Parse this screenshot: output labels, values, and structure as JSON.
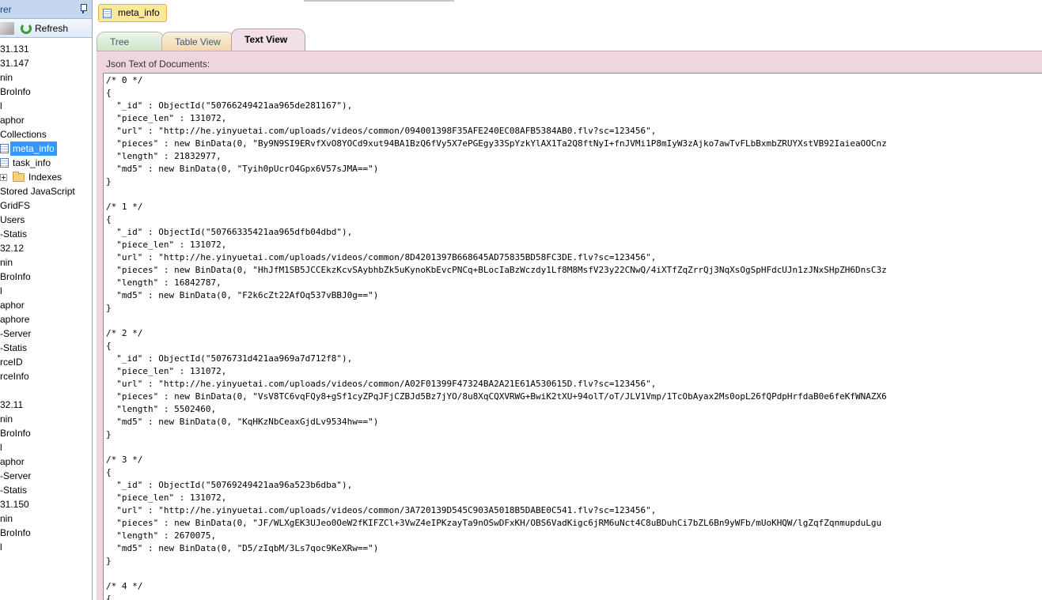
{
  "explorer": {
    "title": "rer",
    "refresh_label": "Refresh",
    "items": [
      {
        "label": "31.131"
      },
      {
        "label": "31.147"
      },
      {
        "label": "nin"
      },
      {
        "label": "BroInfo"
      },
      {
        "label": "l"
      },
      {
        "label": "aphor"
      },
      {
        "label": "Collections"
      },
      {
        "label": "meta_info"
      },
      {
        "label": "task_info"
      },
      {
        "label": "Indexes"
      },
      {
        "label": "Stored JavaScript"
      },
      {
        "label": "GridFS"
      },
      {
        "label": "Users"
      },
      {
        "label": "-Statis"
      },
      {
        "label": "32.12"
      },
      {
        "label": "nin"
      },
      {
        "label": "BroInfo"
      },
      {
        "label": "l"
      },
      {
        "label": "aphor"
      },
      {
        "label": "aphore"
      },
      {
        "label": "-Server"
      },
      {
        "label": "-Statis"
      },
      {
        "label": "rceID"
      },
      {
        "label": "rceInfo"
      },
      {
        "label": ""
      },
      {
        "label": "32.11"
      },
      {
        "label": "nin"
      },
      {
        "label": "BroInfo"
      },
      {
        "label": "l"
      },
      {
        "label": "aphor"
      },
      {
        "label": "-Server"
      },
      {
        "label": "-Statis"
      },
      {
        "label": "31.150"
      },
      {
        "label": "nin"
      },
      {
        "label": "BroInfo"
      },
      {
        "label": "l"
      }
    ]
  },
  "document_tab": {
    "label": "meta_info"
  },
  "view_tabs": {
    "tree": "Tree View",
    "table": "Table View",
    "text": "Text View"
  },
  "json_panel": {
    "label": "Json Text of Documents:",
    "lines": [
      "/* 0 */",
      "{",
      "  \"_id\" : ObjectId(\"50766249421aa965de281167\"),",
      "  \"piece_len\" : 131072,",
      "  \"url\" : \"http://he.yinyuetai.com/uploads/videos/common/094001398F35AFE240EC08AFB5384AB0.flv?sc=123456\",",
      "  \"pieces\" : new BinData(0, \"By9N9SI9ERvfXvO8YOCd9xut94BA1BzQ6fVy5X7ePGEgy33SpYzkYlAX1Ta2Q8ftNyI+fnJVMi1P8mIyW3zAjko7awTvFLbBxmbZRUYXstVB92IaieaOOCnz",
      "  \"length\" : 21832977,",
      "  \"md5\" : new BinData(0, \"Tyih0pUcrO4Gpx6V57sJMA==\")",
      "}",
      "",
      "/* 1 */",
      "{",
      "  \"_id\" : ObjectId(\"50766335421aa965dfb04dbd\"),",
      "  \"piece_len\" : 131072,",
      "  \"url\" : \"http://he.yinyuetai.com/uploads/videos/common/8D4201397B668645AD75835BD58FC3DE.flv?sc=123456\",",
      "  \"pieces\" : new BinData(0, \"HhJfM1SB5JCCEkzKcvSAybhbZk5uKynoKbEvcPNCq+BLocIaBzWczdy1Lf8M8MsfV23y22CNwQ/4iXTfZqZrrQj3NqXsOgSpHFdcUJn1zJNxSHpZH6DnsC3z",
      "  \"length\" : 16842787,",
      "  \"md5\" : new BinData(0, \"F2k6cZt22AfOq537vBBJ0g==\")",
      "}",
      "",
      "/* 2 */",
      "{",
      "  \"_id\" : ObjectId(\"5076731d421aa969a7d712f8\"),",
      "  \"piece_len\" : 131072,",
      "  \"url\" : \"http://he.yinyuetai.com/uploads/videos/common/A02F01399F47324BA2A21E61A530615D.flv?sc=123456\",",
      "  \"pieces\" : new BinData(0, \"VsV8TC6vqFQy8+gSf1cyZPqJFjCZBJd5Bz7jYO/8u8XqCQXVRWG+BwiK2tXU+94olT/oT/JLV1Vmp/1TcObAyax2Ms0opL26fQPdpHrfdaB0e6feKfWNAZX6",
      "  \"length\" : 5502460,",
      "  \"md5\" : new BinData(0, \"KqHKzNbCeaxGjdLv9534hw==\")",
      "}",
      "",
      "/* 3 */",
      "{",
      "  \"_id\" : ObjectId(\"50769249421aa96a523b6dba\"),",
      "  \"piece_len\" : 131072,",
      "  \"url\" : \"http://he.yinyuetai.com/uploads/videos/common/3A720139D545C903A5018B5DABE0C541.flv?sc=123456\",",
      "  \"pieces\" : new BinData(0, \"JF/WLXgEK3UJeo0OeW2fKIFZCl+3VwZ4eIPKzayTa9nOSwDFxKH/OBS6VadKigc6jRM6uNct4C8uBDuhCi7bZL6Bn9yWFb/mUoKHQW/lgZqfZqnmupduLgu",
      "  \"length\" : 2670075,",
      "  \"md5\" : new BinData(0, \"D5/zIqbM/3Ls7qoc9KeXRw==\")",
      "}",
      "",
      "/* 4 */",
      "{"
    ]
  },
  "colors": {
    "selection": "#3399ff",
    "text_view_tab": "#f2dfe7",
    "document_tab": "#fde89a"
  },
  "icons": {
    "pin": "pin-icon",
    "refresh": "refresh-icon",
    "collection": "table-icon",
    "folder": "folder-icon"
  }
}
